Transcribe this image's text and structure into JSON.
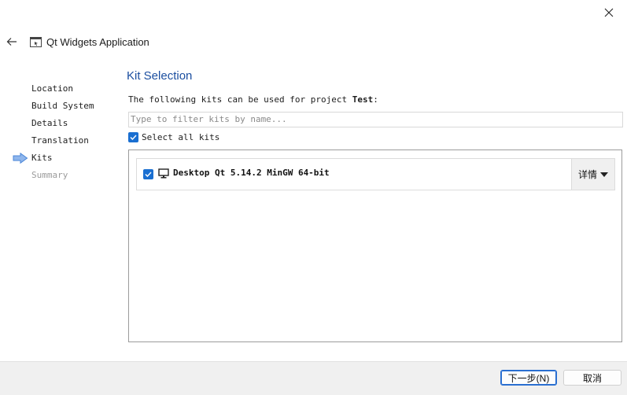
{
  "window": {
    "title": "Qt Widgets Application"
  },
  "steps": [
    {
      "label": "Location",
      "state": "done"
    },
    {
      "label": "Build System",
      "state": "done"
    },
    {
      "label": "Details",
      "state": "done"
    },
    {
      "label": "Translation",
      "state": "done"
    },
    {
      "label": "Kits",
      "state": "current"
    },
    {
      "label": "Summary",
      "state": "pending"
    }
  ],
  "page": {
    "title": "Kit Selection",
    "description_prefix": "The following kits can be used for project ",
    "project_name": "Test",
    "description_suffix": ":",
    "filter_placeholder": "Type to filter kits by name...",
    "select_all_label": "Select all kits"
  },
  "kits": [
    {
      "name": "Desktop Qt 5.14.2 MinGW 64-bit",
      "checked": true,
      "details_label": "详情"
    }
  ],
  "footer": {
    "next_label": "下一步(N)",
    "cancel_label": "取消"
  },
  "colors": {
    "accent": "#1a6fd1",
    "title": "#1c4fa0"
  }
}
